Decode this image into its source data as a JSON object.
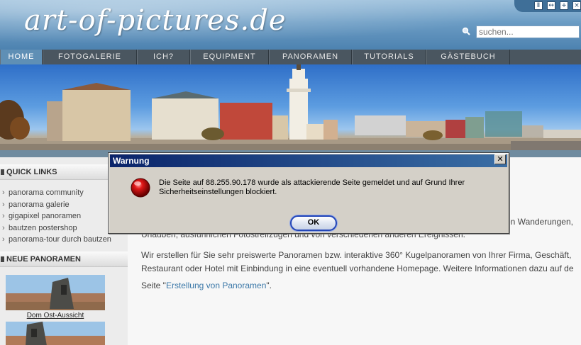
{
  "header": {
    "logo": "art-of-pictures.de",
    "search_placeholder": "suchen...",
    "window_controls": [
      "pause-icon",
      "resize-icon",
      "plus-icon",
      "close-icon"
    ]
  },
  "nav": {
    "items": [
      "HOME",
      "FOTOGALERIE",
      "ICH?",
      "EQUIPMENT",
      "PANORAMEN",
      "TUTORIALS",
      "GÄSTEBUCH"
    ],
    "active": "HOME"
  },
  "sidebar": {
    "quick_links_title": "QUICK LINKS",
    "quick_links": [
      "panorama community",
      "panorama galerie",
      "gigapixel panoramen",
      "bautzen postershop",
      "panorama-tour durch bautzen"
    ],
    "new_panoramas_title": "NEUE PANORAMEN",
    "panoramas": [
      {
        "caption": "Dom Ost-Aussicht"
      }
    ]
  },
  "main": {
    "line1": "en Wanderungen,",
    "line2": "Urlauben, ausführlichen Fotostreifzügen und von verschiedenen anderen Ereignissen.",
    "line3": "Wir erstellen für Sie sehr preiswerte Panoramen bzw. interaktive 360° Kugelpanoramen von Ihrer Firma, Geschäft,",
    "line4": "Restaurant oder Hotel mit Einbindung in eine eventuell vorhandene Homepage. Weitere Informationen dazu auf de",
    "line5_prefix": "Seite \"",
    "line5_link": "Erstellung von Panoramen",
    "line5_suffix": "\"."
  },
  "dialog": {
    "title": "Warnung",
    "message": "Die Seite auf 88.255.90.178 wurde als attackierende Seite gemeldet und auf Grund Ihrer Sicherheitseinstellungen blockiert.",
    "ok_label": "OK",
    "close_symbol": "✕",
    "icon": "red-stop-icon"
  },
  "colors": {
    "header_blue": "#6b9cc4",
    "nav_bg": "#4a5660",
    "nav_active": "#5f8fb5",
    "dialog_title": "#0a246a",
    "link": "#3b78a8"
  }
}
